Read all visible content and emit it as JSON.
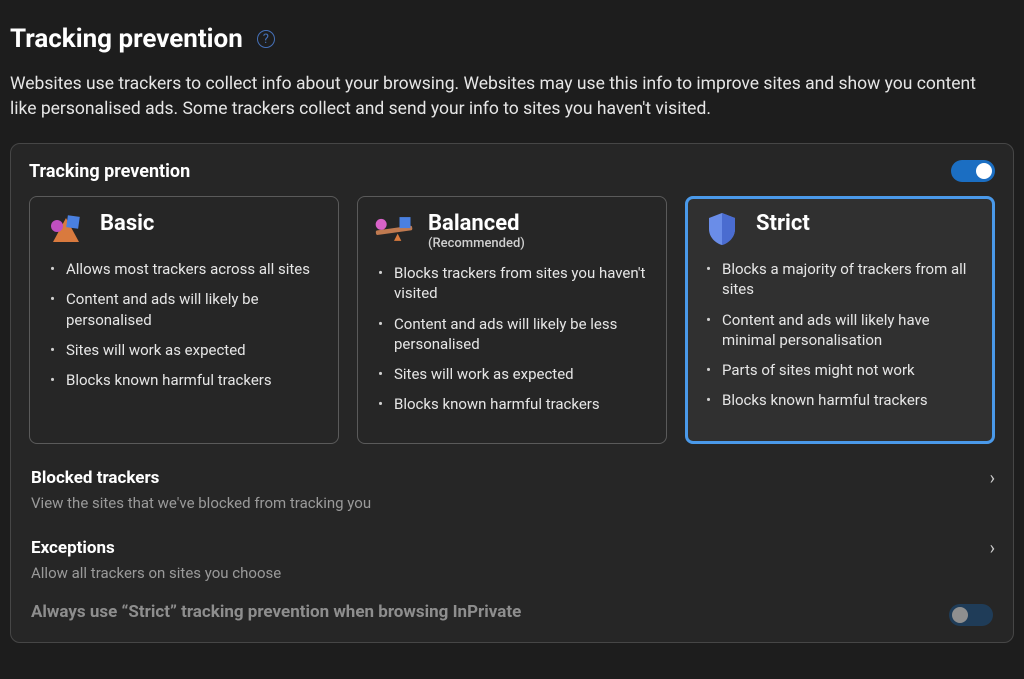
{
  "page": {
    "title": "Tracking prevention",
    "description": "Websites use trackers to collect info about your browsing. Websites may use this info to improve sites and show you content like personalised ads. Some trackers collect and send your info to sites you haven't visited."
  },
  "panel": {
    "header": "Tracking prevention",
    "toggle_on": true,
    "selected_level": "strict",
    "levels": [
      {
        "id": "basic",
        "title": "Basic",
        "subtitle": "",
        "bullets": [
          "Allows most trackers across all sites",
          "Content and ads will likely be personalised",
          "Sites will work as expected",
          "Blocks known harmful trackers"
        ]
      },
      {
        "id": "balanced",
        "title": "Balanced",
        "subtitle": "(Recommended)",
        "bullets": [
          "Blocks trackers from sites you haven't visited",
          "Content and ads will likely be less personalised",
          "Sites will work as expected",
          "Blocks known harmful trackers"
        ]
      },
      {
        "id": "strict",
        "title": "Strict",
        "subtitle": "",
        "bullets": [
          "Blocks a majority of trackers from all sites",
          "Content and ads will likely have minimal personalisation",
          "Parts of sites might not work",
          "Blocks known harmful trackers"
        ]
      }
    ],
    "rows": [
      {
        "id": "blocked",
        "title": "Blocked trackers",
        "subtitle": "View the sites that we've blocked from tracking you",
        "has_chevron": true
      },
      {
        "id": "exceptions",
        "title": "Exceptions",
        "subtitle": "Allow all trackers on sites you choose",
        "has_chevron": true
      }
    ],
    "inprivate_row": {
      "label": "Always use “Strict” tracking prevention when browsing InPrivate",
      "toggle_on": false,
      "disabled": true
    }
  }
}
